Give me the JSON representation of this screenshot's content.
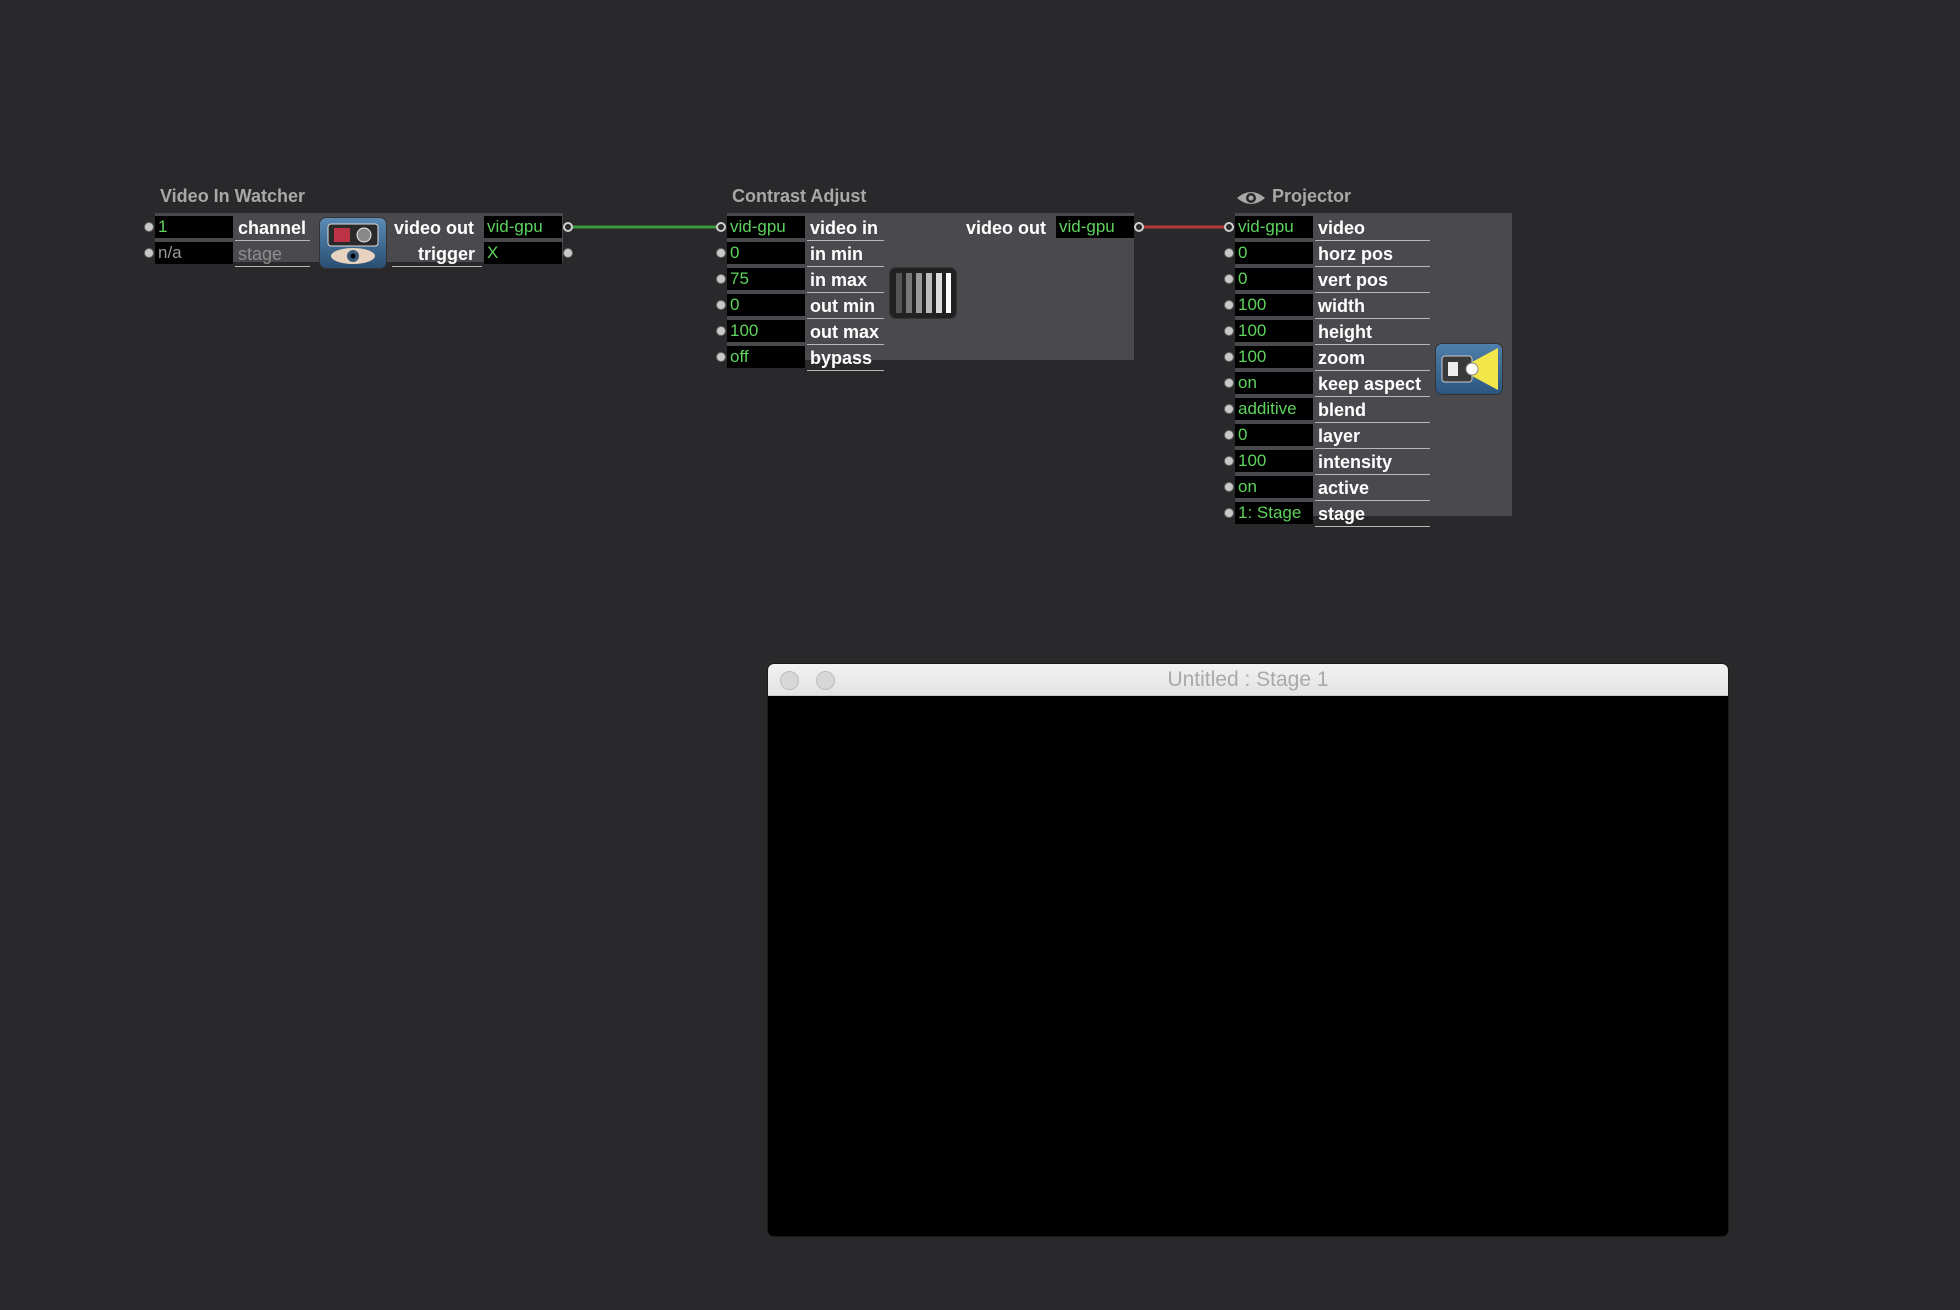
{
  "video_in_watcher": {
    "title": "Video In Watcher",
    "inputs": [
      {
        "value": "1",
        "label": "channel"
      },
      {
        "value": "n/a",
        "label": "stage"
      }
    ],
    "outputs": [
      {
        "label": "video out",
        "value": "vid-gpu"
      },
      {
        "label": "trigger",
        "value": "X"
      }
    ],
    "icon": "camera-eye-icon"
  },
  "contrast_adjust": {
    "title": "Contrast Adjust",
    "inputs": [
      {
        "value": "vid-gpu",
        "label": "video in"
      },
      {
        "value": "0",
        "label": "in min"
      },
      {
        "value": "75",
        "label": "in max"
      },
      {
        "value": "0",
        "label": "out min"
      },
      {
        "value": "100",
        "label": "out max"
      },
      {
        "value": "off",
        "label": "bypass"
      }
    ],
    "outputs": [
      {
        "label": "video out",
        "value": "vid-gpu"
      }
    ],
    "icon": "contrast-bars-icon"
  },
  "projector": {
    "title": "Projector",
    "title_icon": "eye-icon",
    "inputs": [
      {
        "value": "vid-gpu",
        "label": "video"
      },
      {
        "value": "0",
        "label": "horz pos"
      },
      {
        "value": "0",
        "label": "vert pos"
      },
      {
        "value": "100",
        "label": "width"
      },
      {
        "value": "100",
        "label": "height"
      },
      {
        "value": "100",
        "label": "zoom"
      },
      {
        "value": "on",
        "label": "keep aspect"
      },
      {
        "value": "additive",
        "label": "blend"
      },
      {
        "value": "0",
        "label": "layer"
      },
      {
        "value": "100",
        "label": "intensity"
      },
      {
        "value": "on",
        "label": "active"
      },
      {
        "value": "1: Stage",
        "label": "stage"
      }
    ],
    "icon": "projector-icon"
  },
  "connections": [
    {
      "from": "video_in_watcher.video out",
      "to": "contrast_adjust.video in",
      "color": "#3f9a3f"
    },
    {
      "from": "contrast_adjust.video out",
      "to": "projector.video",
      "color": "#b23a3a"
    }
  ],
  "stage_window": {
    "title": "Untitled : Stage 1"
  },
  "colors": {
    "background": "#29292b",
    "actor_body": "#4a4a4e",
    "value_text": "#5fd35f",
    "title_text": "#a8a8a8"
  }
}
